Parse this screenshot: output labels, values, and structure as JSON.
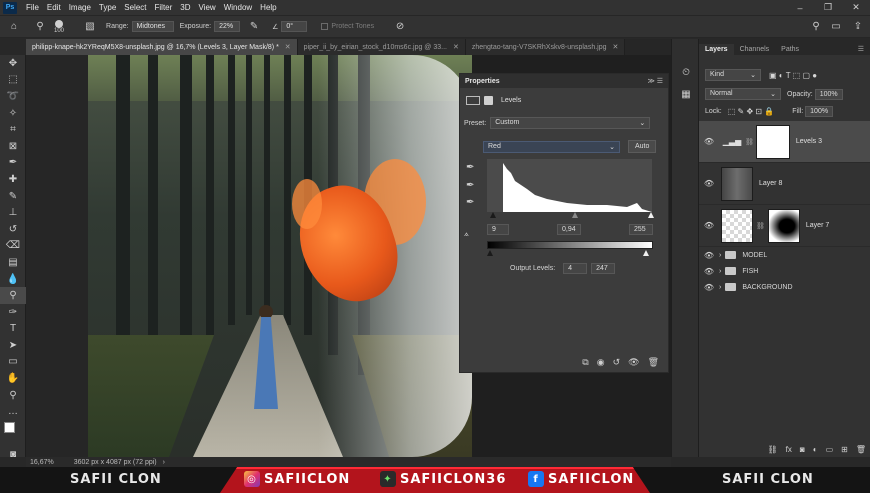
{
  "menubar": {
    "logo": "Ps",
    "items": [
      "File",
      "Edit",
      "Image",
      "Type",
      "Select",
      "Filter",
      "3D",
      "View",
      "Window",
      "Help"
    ]
  },
  "options": {
    "brush_size": "100",
    "range_label": "Range:",
    "range_value": "Midtones",
    "exposure_label": "Exposure:",
    "exposure_value": "22%",
    "angle_value": "0°",
    "protect_tones": "Protect Tones"
  },
  "tabs": [
    {
      "label": "philipp-knape-hk2YReqM5X8-unsplash.jpg @ 16,7% (Levels 3, Layer Mask/8) *",
      "active": true
    },
    {
      "label": "piper_ii_by_eirian_stock_d10ms6c.jpg @ 33...",
      "active": false
    },
    {
      "label": "zhengtao-tang-V7SKRhXskv8-unsplash.jpg",
      "active": false
    }
  ],
  "properties": {
    "title": "Properties",
    "adjustment_name": "Levels",
    "preset_label": "Preset:",
    "preset_value": "Custom",
    "channel_value": "Red",
    "auto_label": "Auto",
    "input_black": "9",
    "input_gamma": "0,94",
    "input_white": "255",
    "output_label": "Output Levels:",
    "output_black": "4",
    "output_white": "247"
  },
  "layers_panel": {
    "tabs": [
      "Layers",
      "Channels",
      "Paths"
    ],
    "kind_label": "Kind",
    "blend_mode": "Normal",
    "opacity_label": "Opacity:",
    "opacity_value": "100%",
    "lock_label": "Lock:",
    "fill_label": "Fill:",
    "fill_value": "100%",
    "layers": [
      {
        "name": "Levels 3",
        "selected": true
      },
      {
        "name": "Layer 8",
        "selected": false
      },
      {
        "name": "Layer 7",
        "selected": false
      }
    ],
    "groups": [
      "MODEL",
      "FISH",
      "BACKGROUND"
    ]
  },
  "status": {
    "zoom": "16,67%",
    "doc_size": "3602 px x 4087 px (72 ppi)"
  },
  "banner": {
    "name_left": "SAFII CLON",
    "instagram": "SAFIICLON",
    "secondary": "SAFIICLON36",
    "facebook": "SAFIICLON",
    "name_right": "SAFII CLON"
  },
  "colors": {
    "accent_red": "#b3141c",
    "panel_bg": "#3c3c3c",
    "ui_bg": "#323232"
  }
}
